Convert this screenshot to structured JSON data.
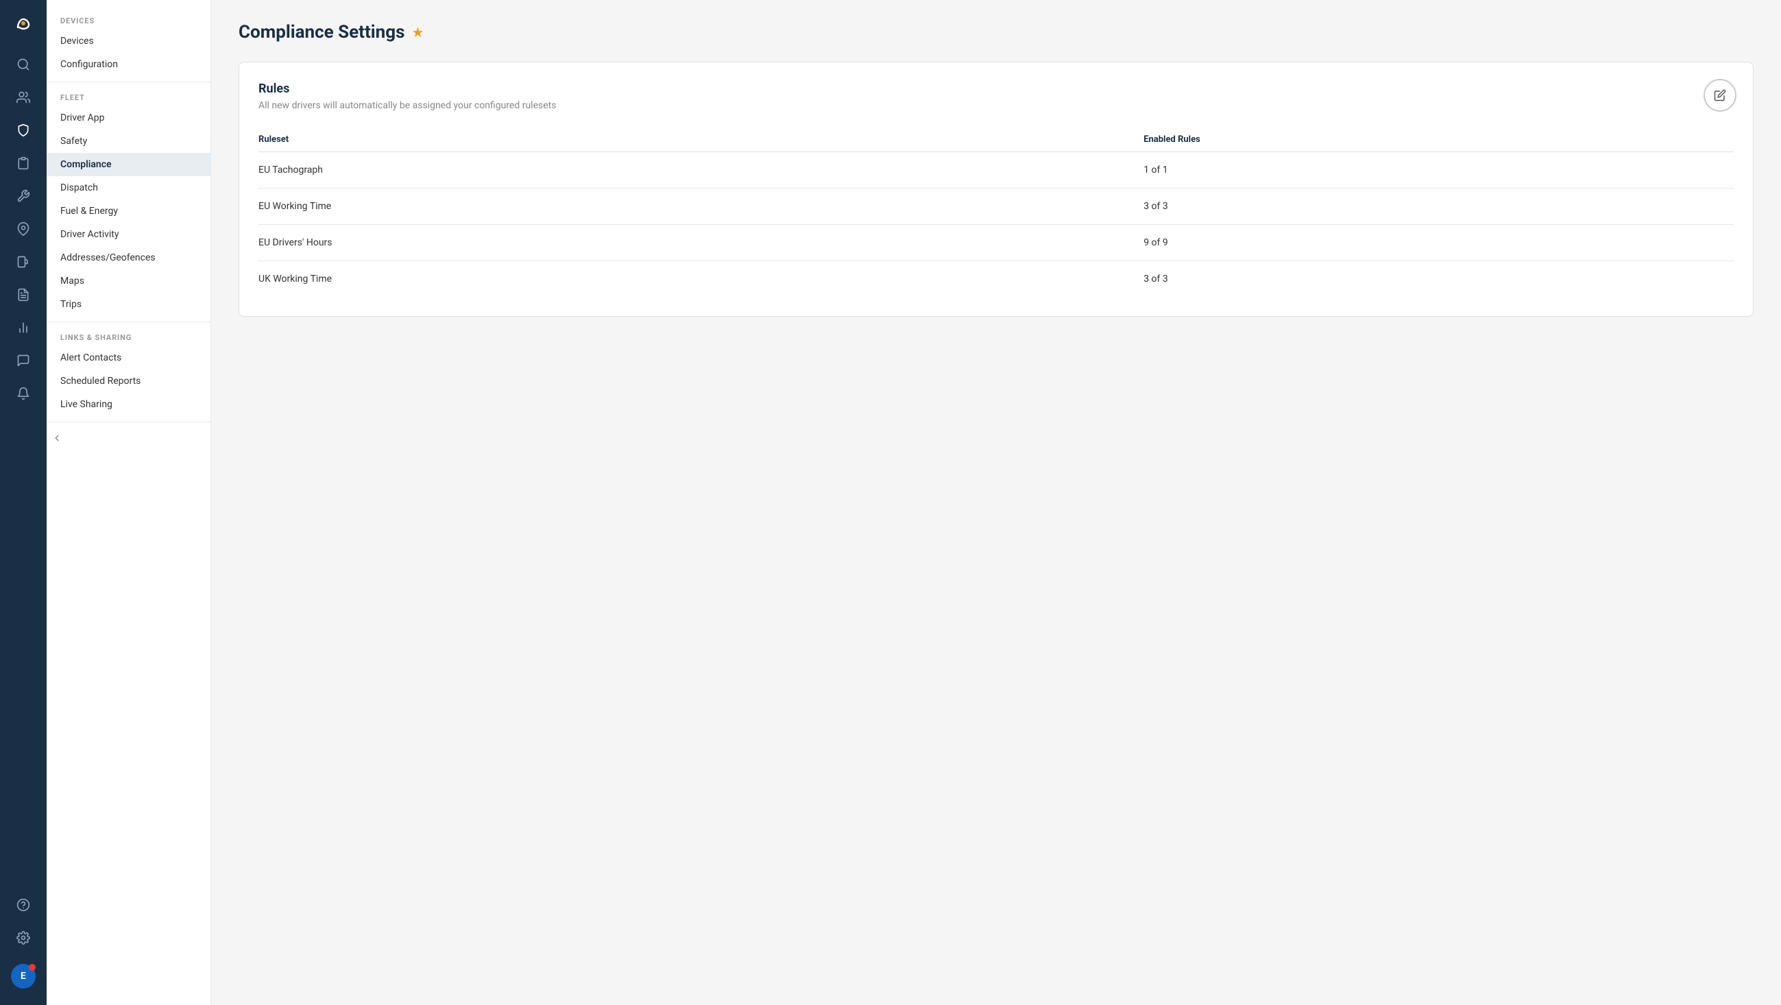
{
  "app": {
    "logo_alt": "Samsara Logo"
  },
  "icon_nav": [
    {
      "name": "search-icon",
      "icon": "🔍",
      "active": false
    },
    {
      "name": "people-icon",
      "icon": "👤",
      "active": false
    },
    {
      "name": "shield-icon",
      "icon": "🛡",
      "active": false
    },
    {
      "name": "clipboard-icon",
      "icon": "📋",
      "active": false
    },
    {
      "name": "wrench-icon",
      "icon": "🔧",
      "active": false
    },
    {
      "name": "map-pin-icon",
      "icon": "📍",
      "active": false
    },
    {
      "name": "fuel-icon",
      "icon": "⛽",
      "active": false
    },
    {
      "name": "report-icon",
      "icon": "📄",
      "active": false
    },
    {
      "name": "chart-icon",
      "icon": "📊",
      "active": false
    },
    {
      "name": "chat-icon",
      "icon": "💬",
      "active": false
    },
    {
      "name": "bell-icon",
      "icon": "🔔",
      "active": false
    },
    {
      "name": "help-icon",
      "icon": "❓",
      "active": false
    },
    {
      "name": "settings-icon",
      "icon": "⚙",
      "active": false
    }
  ],
  "user": {
    "initials": "E",
    "has_notification": true
  },
  "sidebar": {
    "sections": [
      {
        "label": "DEVICES",
        "items": [
          {
            "label": "Devices",
            "active": false
          },
          {
            "label": "Configuration",
            "active": false
          }
        ]
      },
      {
        "label": "FLEET",
        "items": [
          {
            "label": "Driver App",
            "active": false
          },
          {
            "label": "Safety",
            "active": false
          },
          {
            "label": "Compliance",
            "active": true
          },
          {
            "label": "Dispatch",
            "active": false
          },
          {
            "label": "Fuel & Energy",
            "active": false
          },
          {
            "label": "Driver Activity",
            "active": false
          },
          {
            "label": "Addresses/Geofences",
            "active": false
          },
          {
            "label": "Maps",
            "active": false
          },
          {
            "label": "Trips",
            "active": false
          }
        ]
      },
      {
        "label": "LINKS & SHARING",
        "items": [
          {
            "label": "Alert Contacts",
            "active": false
          },
          {
            "label": "Scheduled Reports",
            "active": false
          },
          {
            "label": "Live Sharing",
            "active": false
          }
        ]
      }
    ]
  },
  "page": {
    "title": "Compliance Settings",
    "star_tooltip": "Favorite"
  },
  "rules_card": {
    "title": "Rules",
    "subtitle": "All new drivers will automatically be assigned your configured rulesets",
    "edit_button_label": "Edit",
    "table": {
      "headers": [
        "Ruleset",
        "Enabled Rules"
      ],
      "rows": [
        {
          "ruleset": "EU Tachograph",
          "enabled": "1 of 1"
        },
        {
          "ruleset": "EU Working Time",
          "enabled": "3 of 3"
        },
        {
          "ruleset": "EU Drivers' Hours",
          "enabled": "9 of 9"
        },
        {
          "ruleset": "UK Working Time",
          "enabled": "3 of 3"
        }
      ]
    }
  },
  "collapse": {
    "icon": "❮",
    "label": "Collapse sidebar"
  }
}
